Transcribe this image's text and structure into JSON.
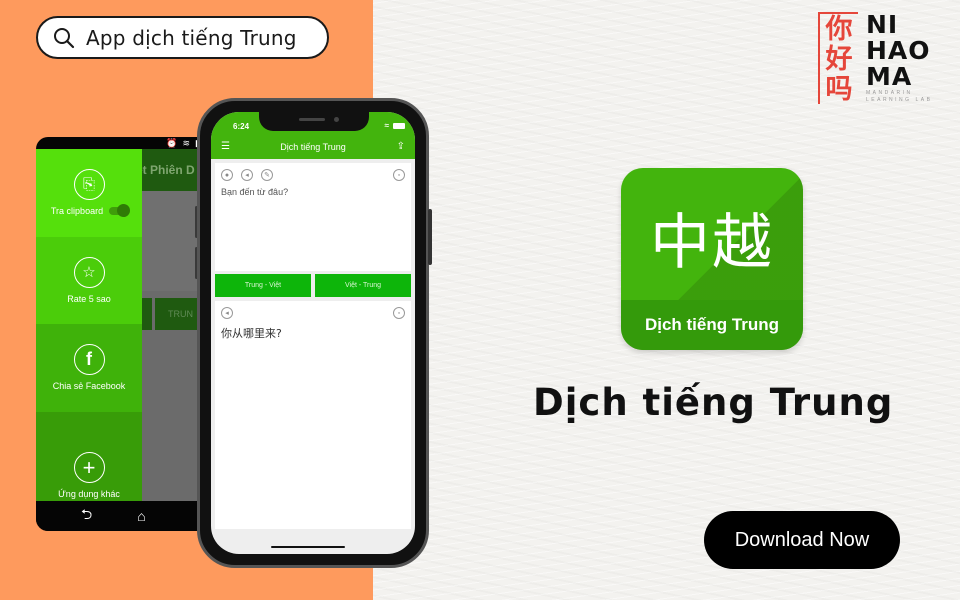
{
  "colors": {
    "orange_bg": "#fe9a5d",
    "app_green": "#43b40d",
    "direction_button_green": "#0db50a",
    "logo_red": "#e5463a"
  },
  "search": {
    "icon": "search-icon",
    "text": "App dịch tiếng Trung"
  },
  "logo": {
    "chinese": [
      "你",
      "好",
      "吗"
    ],
    "latin": [
      "NI",
      "HAO",
      "MA"
    ],
    "subtitle_1": "MANDARIN",
    "subtitle_2": "LEARNING LAB"
  },
  "android_phone": {
    "appbar_title": "ệt Phiên D",
    "button_label": "TRUN",
    "drawer": [
      {
        "icon": "clipboard-icon",
        "glyph": "⎘",
        "label": "Tra clipboard",
        "toggle": true
      },
      {
        "icon": "star-icon",
        "glyph": "☆",
        "label": "Rate 5 sao"
      },
      {
        "icon": "facebook-icon",
        "glyph": "f",
        "label": "Chia sẻ Facebook"
      },
      {
        "icon": "plus-icon",
        "glyph": "+",
        "label": "Ứng dụng khác"
      }
    ],
    "nav": {
      "back": "⮌",
      "home": "⌂"
    }
  },
  "iphone": {
    "time": "6:24",
    "title": "Dịch tiếng Trung",
    "input_text": "Bạn đến từ đâu?",
    "direction_buttons": [
      "Trung - Việt",
      "Việt - Trung"
    ],
    "output_text": "你从哪里来?"
  },
  "app_icon": {
    "glyphs": "中越",
    "label": "Dịch tiếng Trung"
  },
  "headline": "Dịch tiếng Trung",
  "download_button": "Download Now"
}
